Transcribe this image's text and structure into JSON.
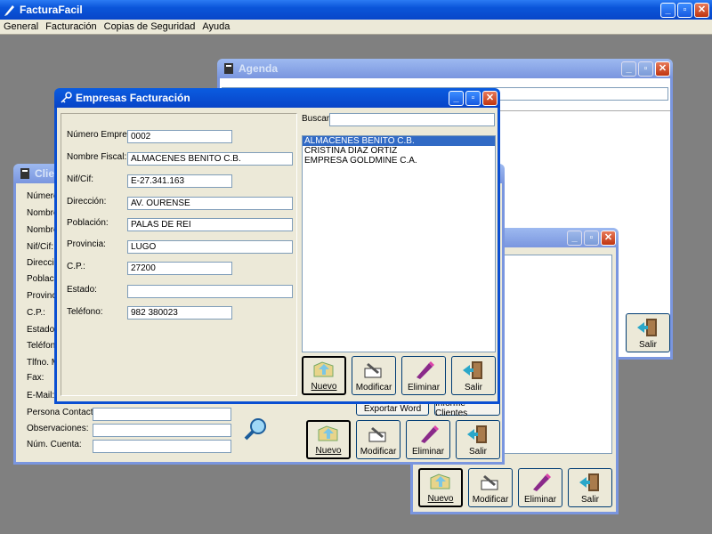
{
  "app": {
    "title": "FacturaFacil",
    "menu": [
      "General",
      "Facturación",
      "Copias de Seguridad",
      "Ayuda"
    ]
  },
  "agenda": {
    "title": "Agenda",
    "buttons": {
      "salir": "Salir"
    }
  },
  "clientes": {
    "title": "Client",
    "labels": [
      "Número",
      "Nombre",
      "Nombre",
      "Nif/Cif:",
      "Direcció",
      "Població",
      "Provinci",
      "C.P.:",
      "Estado:",
      "Teléfono",
      "Tlfno. Mó",
      "Fax:",
      "E-Mail:",
      "Persona Contacto:",
      "Observaciones:",
      "Núm. Cuenta:"
    ],
    "buttons": {
      "exportar_word": "Exportar Word",
      "informe_clientes": "Informe Clientes",
      "nuevo": "Nuevo",
      "modificar": "Modificar",
      "eliminar": "Eliminar",
      "salir": "Salir"
    }
  },
  "third": {
    "buttons": {
      "nuevo": "Nuevo",
      "modificar": "Modificar",
      "eliminar": "Eliminar",
      "salir": "Salir"
    }
  },
  "empresas": {
    "title": "Empresas Facturación",
    "fields": {
      "numero_label": "Número Empresa:",
      "numero": "0002",
      "nombre_label": "Nombre Fiscal:",
      "nombre": "ALMACENES BENITO C.B.",
      "nif_label": "Nif/Cif:",
      "nif": "E-27.341.163",
      "direccion_label": "Dirección:",
      "direccion": "AV. OURENSE",
      "poblacion_label": "Población:",
      "poblacion": "PALAS DE REI",
      "provincia_label": "Provincia:",
      "provincia": "LUGO",
      "cp_label": "C.P.:",
      "cp": "27200",
      "estado_label": "Estado:",
      "estado": "",
      "telefono_label": "Teléfono:",
      "telefono": "982 380023"
    },
    "buscar_label": "Buscar:",
    "list": [
      "ALMACENES BENITO C.B.",
      "CRISTINA DIAZ ORTIZ",
      "EMPRESA GOLDMINE C.A."
    ],
    "selected_index": 0,
    "buttons": {
      "nuevo": "Nuevo",
      "modificar": "Modificar",
      "eliminar": "Eliminar",
      "salir": "Salir"
    }
  }
}
